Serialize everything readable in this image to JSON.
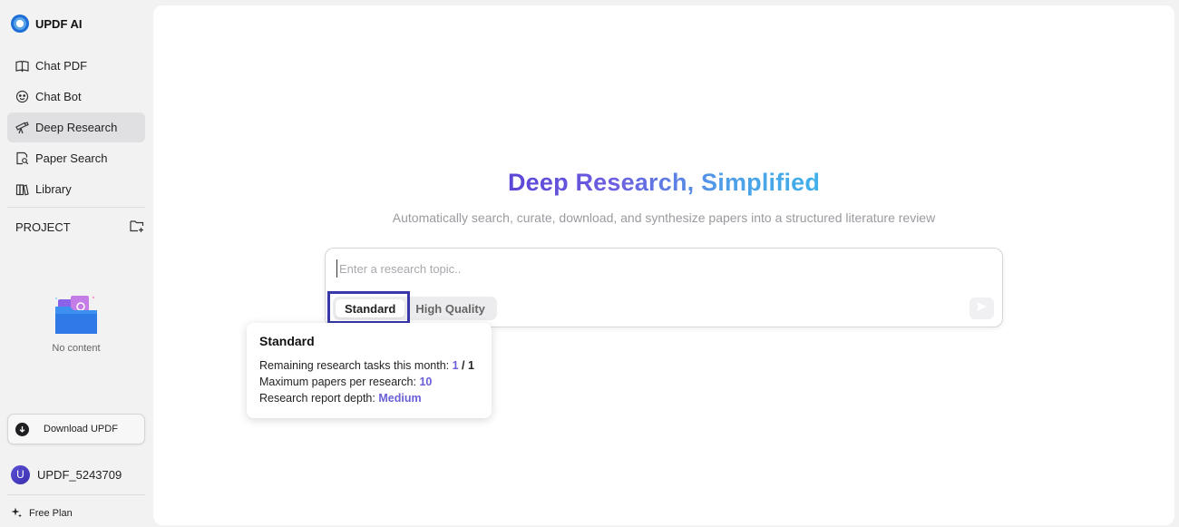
{
  "app": {
    "name": "UPDF AI"
  },
  "sidebar": {
    "items": [
      {
        "label": "Chat PDF",
        "icon": "book-icon"
      },
      {
        "label": "Chat Bot",
        "icon": "bot-icon"
      },
      {
        "label": "Deep Research",
        "icon": "telescope-icon",
        "active": true
      },
      {
        "label": "Paper Search",
        "icon": "doc-search-icon"
      },
      {
        "label": "Library",
        "icon": "library-icon"
      }
    ],
    "project_label": "PROJECT",
    "empty_text": "No content",
    "download_label": "Download UPDF",
    "user_initial": "U",
    "user_name": "UPDF_5243709",
    "plan_label": "Free Plan"
  },
  "main": {
    "headline": "Deep Research, Simplified",
    "subheadline": "Automatically search, curate, download, and synthesize papers into a structured literature review",
    "input_placeholder": "Enter a research topic..",
    "modes": [
      {
        "label": "Standard",
        "selected": true
      },
      {
        "label": "High Quality",
        "selected": false
      }
    ]
  },
  "tooltip": {
    "title": "Standard",
    "rows": [
      {
        "label": "Remaining research tasks this month:",
        "value_used": "1",
        "separator": "/",
        "value_total": "1"
      },
      {
        "label": "Maximum papers per research:",
        "value": "10"
      },
      {
        "label": "Research report depth:",
        "value": "Medium"
      }
    ]
  },
  "colors": {
    "accent": "#6a5fd8",
    "highlight_box": "#3838a8",
    "active_nav_bg": "#e0e0e2"
  }
}
